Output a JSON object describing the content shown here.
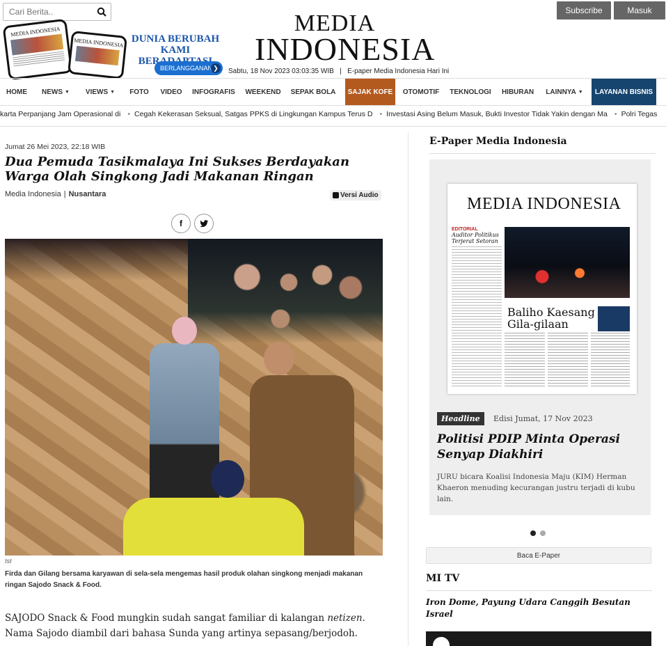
{
  "header": {
    "search_placeholder": "Cari Berita..",
    "subscribe_label": "Subscribe",
    "login_label": "Masuk",
    "promo_line1": "DUNIA BERUBAH",
    "promo_line2": "KAMI BERADAPTASI",
    "promo_button": "BERLANGGANAN",
    "phone_mast": "MEDIA INDONESIA",
    "logo_line1": "MEDIA",
    "logo_line2": "INDONESIA",
    "date": "Sabtu, 18 Nov 2023 03:03:35 WIB",
    "epaper_link": "E-paper Media Indonesia Hari Ini"
  },
  "nav": {
    "items": [
      {
        "label": "HOME",
        "dropdown": false
      },
      {
        "label": "NEWS",
        "dropdown": true
      },
      {
        "label": "VIEWS",
        "dropdown": true
      },
      {
        "label": "FOTO",
        "dropdown": false
      },
      {
        "label": "VIDEO",
        "dropdown": false
      },
      {
        "label": "INFOGRAFIS",
        "dropdown": false
      },
      {
        "label": "WEEKEND",
        "dropdown": false
      },
      {
        "label": "SEPAK BOLA",
        "dropdown": false
      },
      {
        "label": "SAJAK KOFE",
        "dropdown": false,
        "active": true
      },
      {
        "label": "OTOMOTIF",
        "dropdown": false
      },
      {
        "label": "TEKNOLOGI",
        "dropdown": false
      },
      {
        "label": "HIBURAN",
        "dropdown": false
      },
      {
        "label": "LAINNYA",
        "dropdown": true
      }
    ],
    "business_label": "LAYANAN BISNIS",
    "active_color": "#b35a1f",
    "business_color": "#16456f"
  },
  "ticker": [
    "karta Perpanjang Jam Operasional di",
    "Cegah Kekerasan Seksual, Satgas PPKS di Lingkungan Kampus Terus D",
    "Investasi Asing Belum Masuk, Bukti Investor Tidak Yakin dengan Ma",
    "Polri Tegaskan Netral"
  ],
  "article": {
    "date": "Jumat 26 Mei 2023, 22:18 WIB",
    "title": "Dua Pemuda Tasikmalaya Ini Sukses Berdayakan Warga Olah Singkong Jadi Makanan Ringan",
    "author": "Media Indonesia",
    "separator": "|",
    "section": "Nusantara",
    "audio_label": "Versi Audio",
    "share_facebook": "f",
    "share_twitter": "t",
    "photo_credit": "Ist",
    "caption": "Firda dan Gilang bersama karyawan di sela-sela mengemas hasil produk olahan singkong menjadi makanan ringan Sajodo Snack & Food.",
    "lead_part1": "SAJODO Snack & Food mungkin sudah sangat familiar di kalangan ",
    "lead_italic": "netizen",
    "lead_part2": ". Nama Sajodo diambil dari bahasa Sunda yang artinya sepasang/berjodoh."
  },
  "sidebar": {
    "epaper_title": "E-Paper Media Indonesia",
    "page_mast": "MEDIA INDONESIA",
    "page_kicker": "EDITORIAL",
    "page_left_headline": "Auditor Politikus Terjerat Setoran",
    "page_headline_1": "Baliho Kaesang",
    "page_headline_2": "Gila-gilaan",
    "headline_tag": "Headline",
    "edition": "Edisi Jumat, 17 Nov 2023",
    "headline_title": "Politisi PDIP Minta Operasi Senyap Diakhiri",
    "headline_summary": "JURU  bicara Koalisi Indonesia Maju (KIM) Herman Khaeron menuding kecurangan justru terjadi di kubu lain.",
    "carousel_active": 1,
    "carousel_total": 2,
    "read_epaper_label": "Baca E-Paper",
    "mitv_title": "MI TV",
    "mitv_headline": "Iron Dome, Payung Udara Canggih Besutan Israel"
  }
}
